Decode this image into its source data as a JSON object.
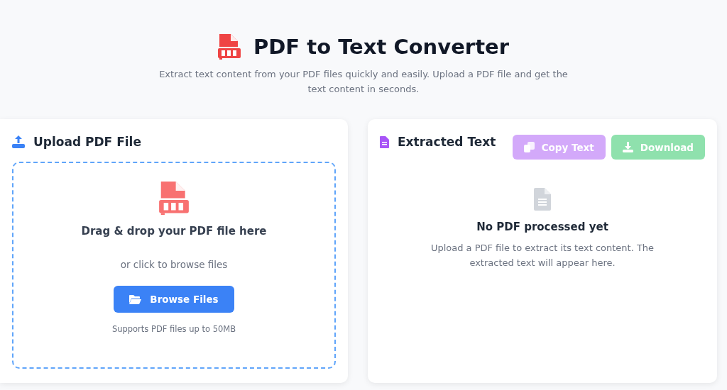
{
  "header": {
    "title": "PDF to Text Converter",
    "subtitle": "Extract text content from your PDF files quickly and easily. Upload a PDF file and get the text content in seconds."
  },
  "upload_panel": {
    "title": "Upload PDF File",
    "dropzone": {
      "heading": "Drag & drop your PDF file here",
      "hint": "or click to browse files",
      "button": "Browse Files",
      "note": "Supports PDF files up to 50MB"
    }
  },
  "result_panel": {
    "title": "Extracted Text",
    "buttons": [
      {
        "kind": "copy",
        "label": "Copy Text",
        "disabled": true
      },
      {
        "kind": "download",
        "label": "Download",
        "disabled": true
      }
    ],
    "empty_state": {
      "heading": "No PDF processed yet",
      "message": "Upload a PDF file to extract its text content. The extracted text will appear here."
    }
  }
}
